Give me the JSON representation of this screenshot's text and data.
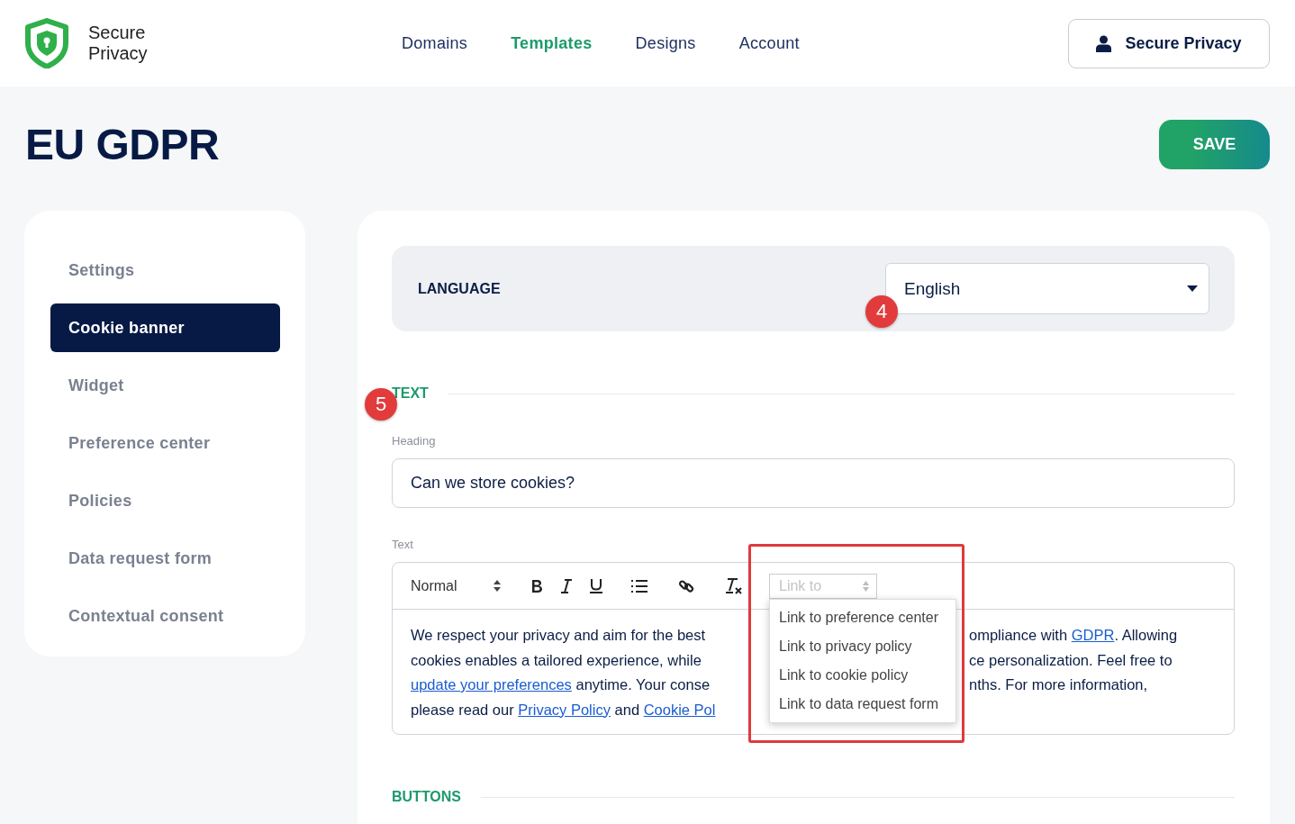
{
  "header": {
    "logo_text": [
      "Secure",
      "Privacy"
    ],
    "nav": [
      {
        "label": "Domains",
        "selected": false
      },
      {
        "label": "Templates",
        "selected": true
      },
      {
        "label": "Designs",
        "selected": false
      },
      {
        "label": "Account",
        "selected": false
      }
    ],
    "account_button": "Secure Privacy"
  },
  "page_title": "EU GDPR",
  "save_button": "SAVE",
  "sidebar": {
    "items": [
      {
        "label": "Settings",
        "selected": false
      },
      {
        "label": "Cookie banner",
        "selected": true
      },
      {
        "label": "Widget",
        "selected": false
      },
      {
        "label": "Preference center",
        "selected": false
      },
      {
        "label": "Policies",
        "selected": false
      },
      {
        "label": "Data request form",
        "selected": false
      },
      {
        "label": "Contextual consent",
        "selected": false
      }
    ]
  },
  "language": {
    "label": "LANGUAGE",
    "value": "English",
    "marker": "4"
  },
  "text_section": {
    "title": "TEXT",
    "marker": "5",
    "heading_label": "Heading",
    "heading_value": "Can we store cookies?",
    "text_label": "Text",
    "toolbar": {
      "format": "Normal",
      "link_select": {
        "placeholder": "Link to",
        "expanded": true,
        "highlighted": true,
        "options": [
          "Link to preference center",
          "Link to privacy policy",
          "Link to cookie policy",
          "Link to data request form"
        ]
      }
    },
    "body_lines": [
      {
        "left": [
          {
            "text": "We respect your privacy and aim for the best",
            "link": false
          }
        ],
        "right": [
          {
            "text": "ompliance with ",
            "link": false
          },
          {
            "text": "GDPR",
            "link": true
          },
          {
            "text": ". Allowing",
            "link": false
          }
        ]
      },
      {
        "left": [
          {
            "text": "cookies enables a tailored experience, while",
            "link": false
          }
        ],
        "right": [
          {
            "text": "ce personalization. Feel free to",
            "link": false
          }
        ]
      },
      {
        "left": [
          {
            "text": "update your preferences",
            "link": true
          },
          {
            "text": " anytime. Your conse",
            "link": false
          }
        ],
        "right": [
          {
            "text": "nths. For more information,",
            "link": false
          }
        ]
      },
      {
        "left": [
          {
            "text": "please read our ",
            "link": false
          },
          {
            "text": "Privacy Policy",
            "link": true
          },
          {
            "text": " and ",
            "link": false
          },
          {
            "text": "Cookie Pol",
            "link": true
          }
        ]
      }
    ]
  },
  "buttons_section": {
    "title": "BUTTONS"
  }
}
